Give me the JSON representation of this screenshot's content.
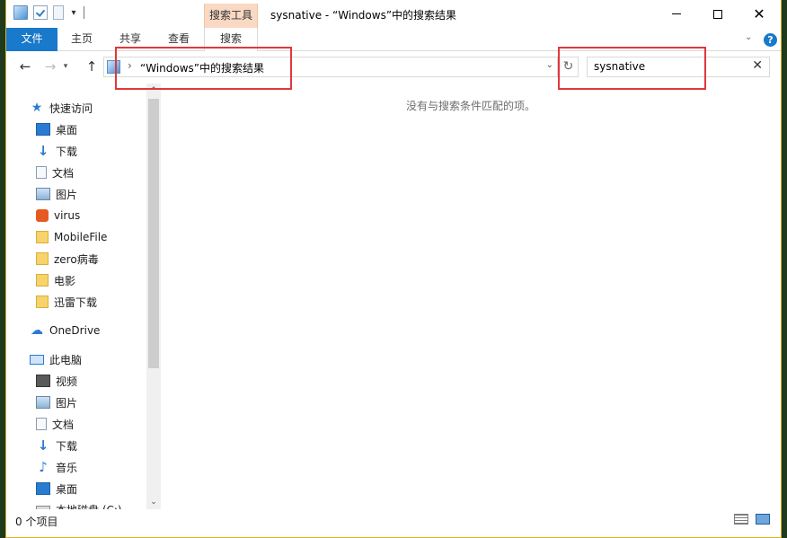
{
  "window": {
    "title": "sysnative - “Windows”中的搜索结果",
    "contextual_tab_group": "搜索工具",
    "controls": {
      "minimize": "—",
      "maximize": "☐",
      "close": "✕"
    }
  },
  "ribbon": {
    "tabs": [
      {
        "label": "文件",
        "active": false
      },
      {
        "label": "主页",
        "active": false
      },
      {
        "label": "共享",
        "active": false
      },
      {
        "label": "查看",
        "active": false
      },
      {
        "label": "搜索",
        "active": true
      }
    ]
  },
  "navigation": {
    "address_path": "“Windows”中的搜索结果",
    "search_query": "sysnative"
  },
  "sidebar": {
    "quick_access": {
      "label": "快速访问",
      "items": [
        {
          "label": "桌面",
          "icon": "desktop-icon",
          "pinned": true
        },
        {
          "label": "下载",
          "icon": "download-icon",
          "pinned": true
        },
        {
          "label": "文档",
          "icon": "document-icon",
          "pinned": true
        },
        {
          "label": "图片",
          "icon": "pictures-icon",
          "pinned": true
        },
        {
          "label": "virus",
          "icon": "virus-folder-icon",
          "pinned": true
        },
        {
          "label": "MobileFile",
          "icon": "folder-icon",
          "pinned": false
        },
        {
          "label": "zero病毒",
          "icon": "folder-icon",
          "pinned": false
        },
        {
          "label": "电影",
          "icon": "folder-icon",
          "pinned": false
        },
        {
          "label": "迅雷下载",
          "icon": "folder-icon",
          "pinned": false
        }
      ]
    },
    "onedrive": {
      "label": "OneDrive"
    },
    "this_pc": {
      "label": "此电脑",
      "items": [
        {
          "label": "视频",
          "icon": "videos-icon"
        },
        {
          "label": "图片",
          "icon": "pictures-icon"
        },
        {
          "label": "文档",
          "icon": "document-icon"
        },
        {
          "label": "下载",
          "icon": "download-icon"
        },
        {
          "label": "音乐",
          "icon": "music-icon"
        },
        {
          "label": "桌面",
          "icon": "desktop-icon"
        },
        {
          "label": "本地磁盘 (C:)",
          "icon": "drive-icon"
        }
      ]
    }
  },
  "content": {
    "empty_message": "没有与搜索条件匹配的项。"
  },
  "status_bar": {
    "item_count": "0 个项目"
  },
  "colors": {
    "accent": "#1979ca",
    "contextual_tab": "#f9d9c3",
    "highlight_box": "#e0383a",
    "window_border": "#e1b41f"
  }
}
